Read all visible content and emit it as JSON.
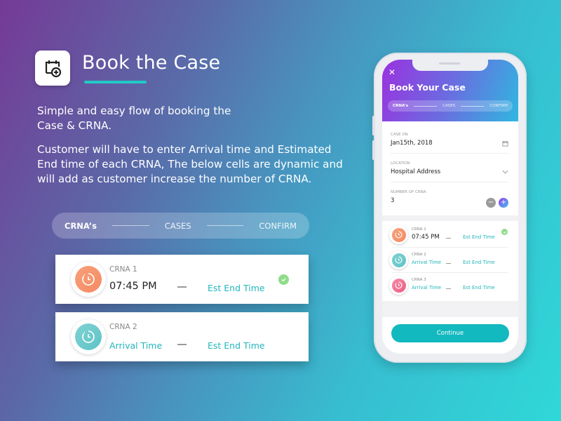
{
  "hero": {
    "title": "Book the Case",
    "icon": "calendar-add-icon",
    "description_1": "Simple and easy flow of booking the Case & CRNA.",
    "description_2": "Customer will have to enter Arrival time and Estimated End time of each CRNA, The below cells are dynamic and will add as customer increase the number of CRNA."
  },
  "stepper": {
    "steps": [
      {
        "label": "CRNA’s",
        "active": true
      },
      {
        "label": "CASES",
        "active": false
      },
      {
        "label": "CONFIRM",
        "active": false
      }
    ]
  },
  "showcase_cards": [
    {
      "label": "CRNA 1",
      "arrival": "07:45 PM",
      "arrival_filled": true,
      "end": "Est End Time",
      "color": "orange",
      "checked": true
    },
    {
      "label": "CRNA 2",
      "arrival": "Arrival Time",
      "arrival_filled": false,
      "end": "Est End Time",
      "color": "teal",
      "checked": false
    }
  ],
  "phone": {
    "close_icon": "close-icon",
    "title": "Book Your Case",
    "form": {
      "case_on": {
        "label": "CASE ON",
        "value": "Jan15th, 2018",
        "icon": "calendar-icon"
      },
      "location": {
        "label": "LOCATION",
        "value": "Hospital Address",
        "icon": "chevron-down-icon"
      },
      "number_of_crna": {
        "label": "NUMBER OF CRNA",
        "value": "3",
        "minus": "−",
        "plus": "+"
      }
    },
    "rows": [
      {
        "label": "CRNA 1",
        "arrival": "07:45 PM",
        "arrival_filled": true,
        "end": "Est End Time",
        "color": "orange",
        "checked": true
      },
      {
        "label": "CRNA 2",
        "arrival": "Arrival Time",
        "arrival_filled": false,
        "end": "Est End Time",
        "color": "teal",
        "checked": false
      },
      {
        "label": "CRNA 3",
        "arrival": "Arrival Time",
        "arrival_filled": false,
        "end": "Est End Time",
        "color": "pink",
        "checked": false
      }
    ],
    "continue_label": "Continue"
  },
  "colors": {
    "accent_teal": "#12b9be",
    "check_green": "#8fdc8b",
    "orange": "#f58b64",
    "teal": "#5ec3c6",
    "pink": "#ec5f86"
  }
}
